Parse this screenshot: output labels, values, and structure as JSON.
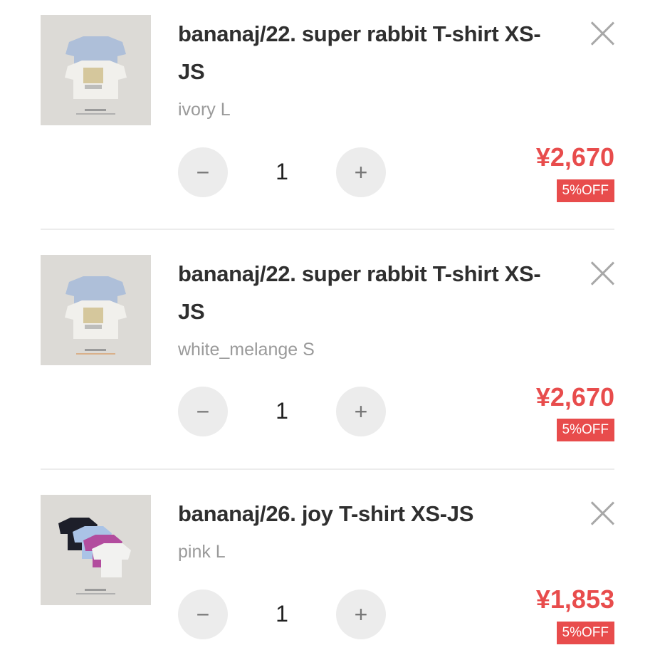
{
  "cart": {
    "items": [
      {
        "title": "bananaj/22. super rabbit T-shirt XS-JS",
        "variant": "ivory L",
        "quantity": "1",
        "price": "¥2,670",
        "discount": "5%OFF",
        "image_icon": "tshirt-stack-photo",
        "minus_label": "−",
        "plus_label": "+"
      },
      {
        "title": "bananaj/22. super rabbit T-shirt XS-JS",
        "variant": "white_melange S",
        "quantity": "1",
        "price": "¥2,670",
        "discount": "5%OFF",
        "image_icon": "tshirt-stack-photo",
        "minus_label": "−",
        "plus_label": "+"
      },
      {
        "title": "bananaj/26. joy T-shirt XS-JS",
        "variant": "pink L",
        "quantity": "1",
        "price": "¥1,853",
        "discount": "5%OFF",
        "image_icon": "tshirt-fan-photo",
        "minus_label": "−",
        "plus_label": "+"
      }
    ]
  },
  "colors": {
    "accent": "#e84c4c",
    "control_bg": "#ececec",
    "muted_text": "#9a9a9a"
  }
}
